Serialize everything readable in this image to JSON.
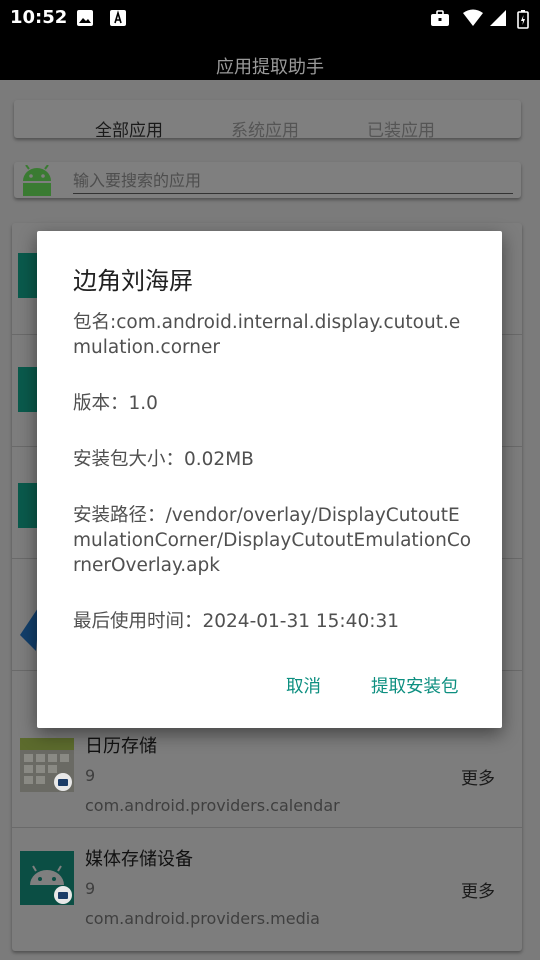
{
  "status_bar": {
    "time": "10:52"
  },
  "app_bar": {
    "title": "应用提取助手"
  },
  "tabs": [
    "全部应用",
    "系统应用",
    "已装应用"
  ],
  "search": {
    "placeholder": "输入要搜索的应用"
  },
  "list": {
    "more_label": "更多",
    "items": [
      {
        "name": "日历存储",
        "version": "9",
        "package": "com.android.providers.calendar",
        "icon": "calendar-app-icon"
      },
      {
        "name": "媒体存储设备",
        "version": "9",
        "package": "com.android.providers.media",
        "icon": "android-app-icon"
      }
    ]
  },
  "dialog": {
    "title": "边角刘海屏",
    "package_line": "包名:com.android.internal.display.cutout.emulation.corner",
    "version_line": "版本：1.0",
    "size_line": "安装包大小：0.02MB",
    "path_line": "安装路径：/vendor/overlay/DisplayCutoutEmulationCorner/DisplayCutoutEmulationCornerOverlay.apk",
    "last_used_line": "最后使用时间：2024-01-31 15:40:31",
    "cancel_label": "取消",
    "extract_label": "提取安装包"
  },
  "colors": {
    "accent": "#0d8f80",
    "icon_green": "#0a7a66",
    "scrim": "#7b7b7b"
  }
}
